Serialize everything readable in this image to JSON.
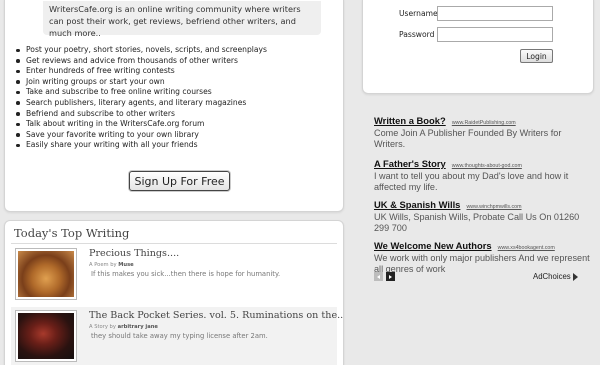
{
  "intro": {
    "description": "WritersCafe.org is an online writing community where writers can post their work, get reviews, befriend other writers, and much more..",
    "features": [
      "Post your poetry, short stories, novels, scripts, and screenplays",
      "Get reviews and advice from thousands of other writers",
      "Enter hundreds of free writing contests",
      "Join writing groups or start your own",
      "Take and subscribe to free online writing courses",
      "Search publishers, literary agents, and literary magazines",
      "Befriend and subscribe to other writers",
      "Talk about writing in the WritersCafe.org forum",
      "Save your favorite writing to your own library",
      "Easily share your writing with all your friends"
    ],
    "signup_label": "Sign Up For Free"
  },
  "top_writing": {
    "title": "Today's Top Writing",
    "items": [
      {
        "headline": "Precious Things....",
        "type_prefix": "A Poem by",
        "author": "Muse",
        "description": "If this makes you sick...then there is hope for humanity."
      },
      {
        "headline": "The Back Pocket Series. vol. 5. Ruminations on the..",
        "type_prefix": "A Story by",
        "author": "arbitrary jane",
        "description": "they should take away my typing license after 2am."
      }
    ]
  },
  "login": {
    "username_label": "Username",
    "password_label": "Password",
    "username_value": "",
    "password_value": "",
    "login_label": "Login"
  },
  "ads": [
    {
      "title": "Written a Book?",
      "url": "www.RaidetPublishing.com",
      "body": "Come Join A Publisher Founded By Writers for Writers."
    },
    {
      "title": "A Father's Story",
      "url": "www.thoughts-about-god.com",
      "body": "I want to tell you about my Dad's love and how it affected my life."
    },
    {
      "title": "UK & Spanish Wills",
      "url": "www.winchpmwills.com",
      "body": "UK Wills, Spanish Wills, Probate Call Us On 01260 299 700"
    },
    {
      "title": "We Welcome New Authors",
      "url": "www.xs4bookagent.com",
      "body": "We work with only major publishers And we represent all genres of work"
    }
  ],
  "adchoices_label": "AdChoices",
  "colors": {
    "page_background": "#e9e9e9",
    "panel_background": "#ffffff",
    "intro_box": "#efefef"
  }
}
